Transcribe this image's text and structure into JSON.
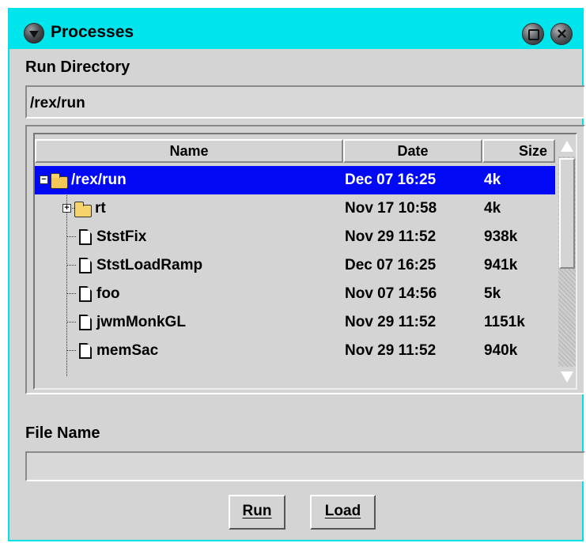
{
  "window": {
    "title": "Processes"
  },
  "run_directory": {
    "label": "Run Directory",
    "value": "/rex/run"
  },
  "file_list": {
    "columns": [
      "Name",
      "Date",
      "Size"
    ],
    "rows": [
      {
        "name": "/rex/run",
        "date": "Dec 07 16:25",
        "size": "4k",
        "type": "folder-open",
        "selected": true
      },
      {
        "name": "rt",
        "date": "Nov 17 10:58",
        "size": "4k",
        "type": "folder",
        "selected": false
      },
      {
        "name": "StstFix",
        "date": "Nov 29 11:52",
        "size": "938k",
        "type": "file",
        "selected": false
      },
      {
        "name": "StstLoadRamp",
        "date": "Dec 07 16:25",
        "size": "941k",
        "type": "file",
        "selected": false
      },
      {
        "name": "foo",
        "date": "Nov 07 14:56",
        "size": "5k",
        "type": "file",
        "selected": false
      },
      {
        "name": "jwmMonkGL",
        "date": "Nov 29 11:52",
        "size": "1151k",
        "type": "file",
        "selected": false
      },
      {
        "name": "memSac",
        "date": "Nov 29 11:52",
        "size": "940k",
        "type": "file",
        "selected": false
      }
    ]
  },
  "file_name": {
    "label": "File Name",
    "value": ""
  },
  "buttons": {
    "run": "Run",
    "load": "Load"
  },
  "colors": {
    "titlebar": "#00e4ec",
    "selection": "#0008f4",
    "panel": "#d4d4d4"
  }
}
